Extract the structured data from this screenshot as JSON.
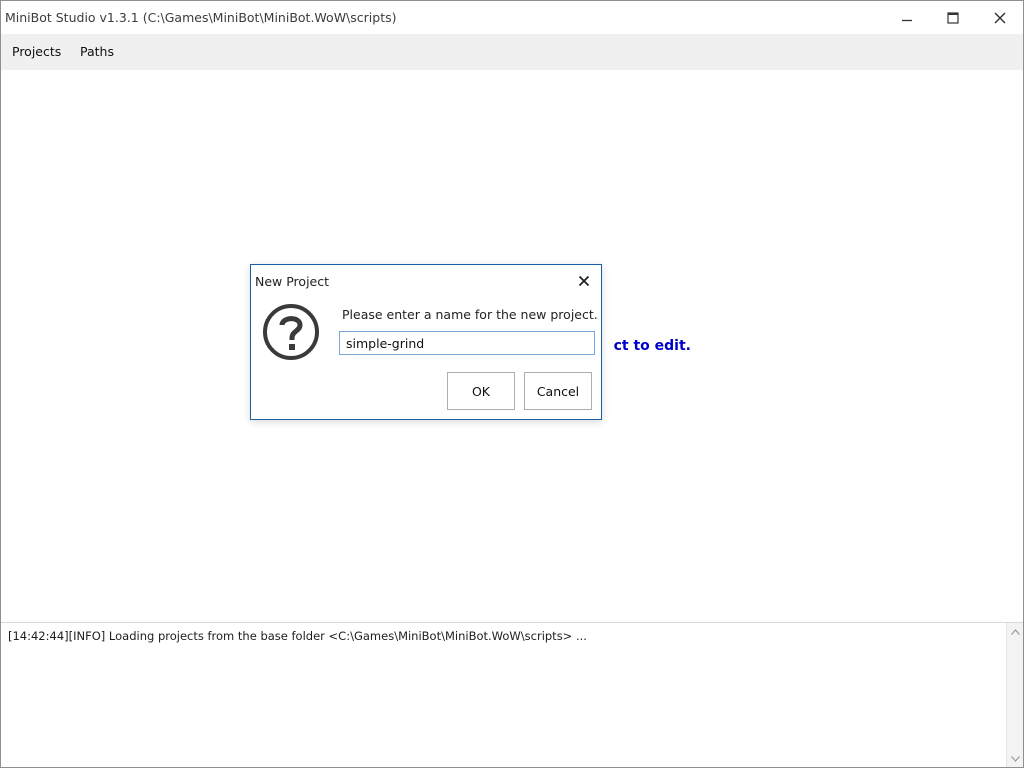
{
  "window": {
    "title": "MiniBot Studio v1.3.1 (C:\\Games\\MiniBot\\MiniBot.WoW\\scripts)",
    "controls": {
      "minimize": "minimize-icon",
      "maximize": "maximize-icon",
      "close": "close-icon"
    }
  },
  "menubar": {
    "items": [
      {
        "label": "Projects"
      },
      {
        "label": "Paths"
      }
    ]
  },
  "content": {
    "hint": "ct to edit."
  },
  "log": {
    "lines": [
      "[14:42:44][INFO] Loading projects from the base folder <C:\\Games\\MiniBot\\MiniBot.WoW\\scripts> ..."
    ]
  },
  "dialog": {
    "title": "New Project",
    "icon": "question-icon",
    "prompt": "Please enter a name for the new project.",
    "input_value": "simple-grind",
    "ok_label": "OK",
    "cancel_label": "Cancel"
  },
  "colors": {
    "hint_text": "#0000cc",
    "dialog_border": "#1a5fa6",
    "input_border": "#7aa7d6",
    "menubar_bg": "#f0f0f0"
  }
}
